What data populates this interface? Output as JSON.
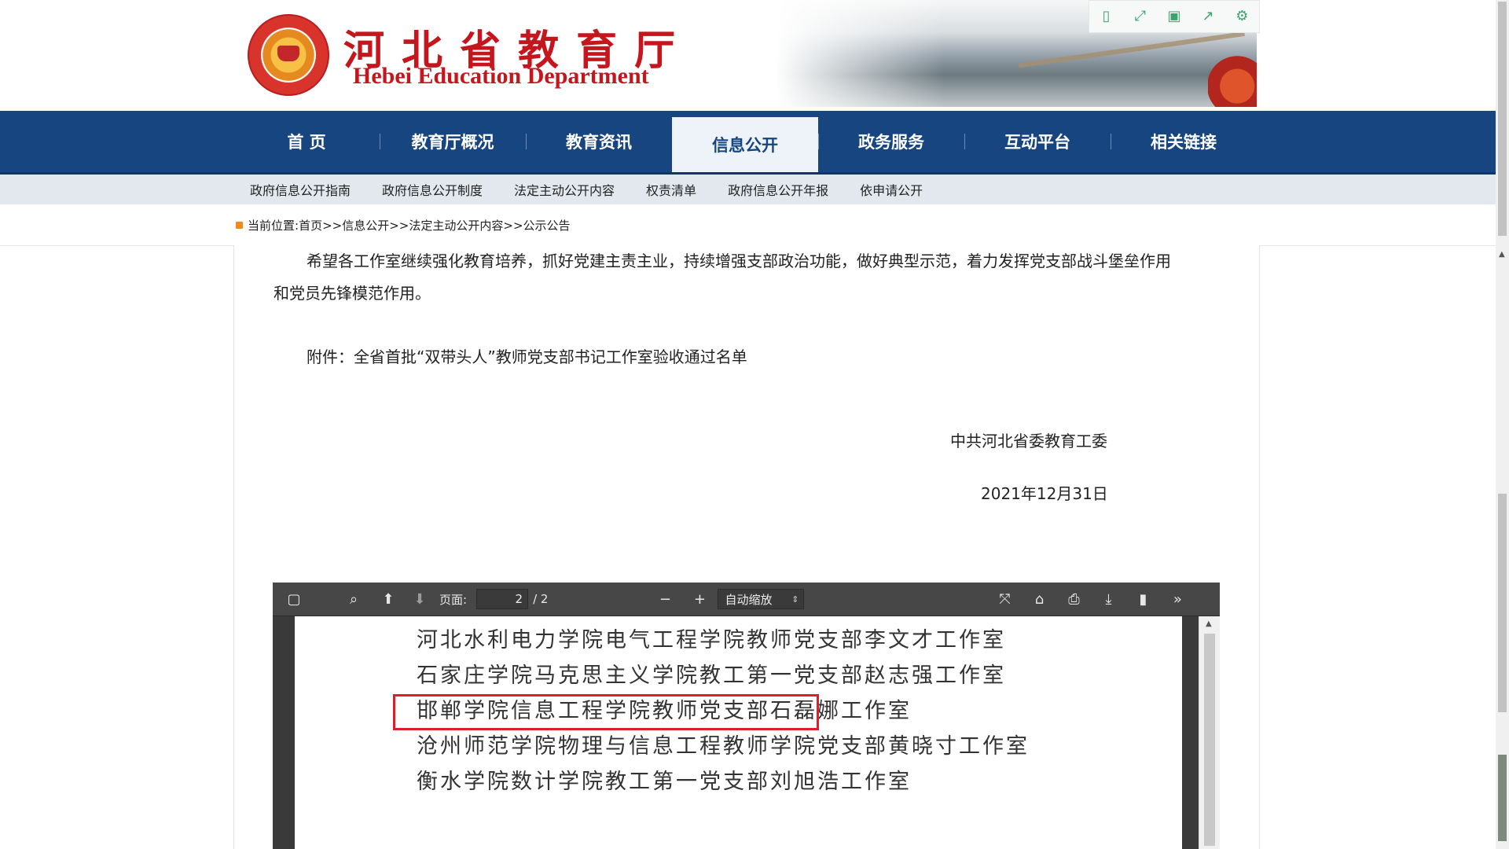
{
  "header": {
    "title_cn": "河北省教育厅",
    "title_en": "Hebei Education Department",
    "logo_icon": "emblem-icon",
    "toolbar_icons": [
      "tablet-icon",
      "fullscreen-icon",
      "save-icon",
      "share-icon",
      "settings-icon"
    ]
  },
  "nav": {
    "items": [
      "首 页",
      "教育厅概况",
      "教育资讯",
      "信息公开",
      "政务服务",
      "互动平台",
      "相关链接"
    ],
    "active": "信息公开"
  },
  "subnav": {
    "items": [
      "政府信息公开指南",
      "政府信息公开制度",
      "法定主动公开内容",
      "权责清单",
      "政府信息公开年报",
      "依申请公开"
    ]
  },
  "breadcrumb": {
    "label": "当前位置:",
    "items": [
      "首页",
      "信息公开",
      "法定主动公开内容",
      "公示公告"
    ],
    "separator": ">>"
  },
  "article": {
    "para1_line1": "希望各工作室继续强化教育培养，抓好党建主责主业，持续增强支部政治功能，做好典型示范，着力发挥党支部战斗堡垒作用",
    "para1_line2": "和党员先锋模范作用。",
    "attachment": "附件：全省首批“双带头人”教师党支部书记工作室验收通过名单",
    "issuer": "中共河北省委教育工委",
    "date": "2021年12月31日"
  },
  "pdf_viewer": {
    "page_label": "页面:",
    "page_value": "2",
    "page_total": "/ 2",
    "zoom": "自动缩放",
    "lines": [
      "河北水利电力学院电气工程学院教师党支部李文才工作室",
      "石家庄学院马克思主义学院教工第一党支部赵志强工作室",
      "邯郸学院信息工程学院教师党支部石磊娜工作室",
      "沧州师范学院物理与信息工程教师学院党支部黄晓寸工作室",
      "衡水学院数计学院教工第一党支部刘旭浩工作室"
    ],
    "highlighted_line": 2,
    "highlight_color": "#e01e2a"
  },
  "colors": {
    "nav_bg": "#16457f",
    "brand_red": "#c4161c",
    "subnav_bg": "#e3e8ef",
    "toolbar_green": "#3aa56b"
  }
}
